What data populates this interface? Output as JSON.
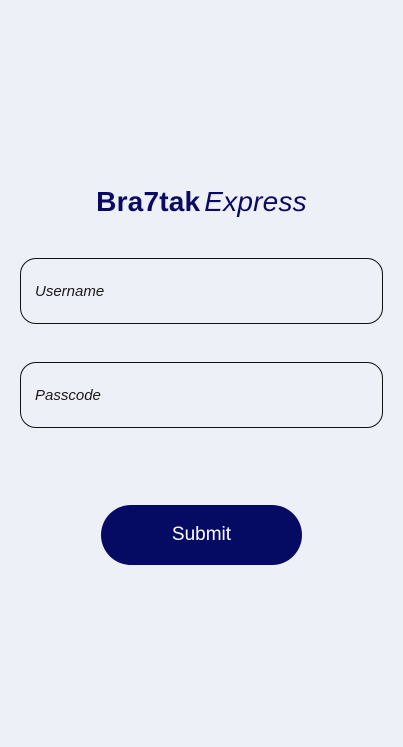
{
  "brand": {
    "name_bold": "Bra7tak",
    "name_light": "Express"
  },
  "form": {
    "username_placeholder": "Username",
    "username_value": "",
    "passcode_placeholder": "Passcode",
    "passcode_value": "",
    "submit_label": "Submit"
  },
  "colors": {
    "background": "#eef0f8",
    "brand": "#0a0a63",
    "button": "#050a63",
    "button_text": "#ffffff",
    "field_border": "#111111"
  }
}
